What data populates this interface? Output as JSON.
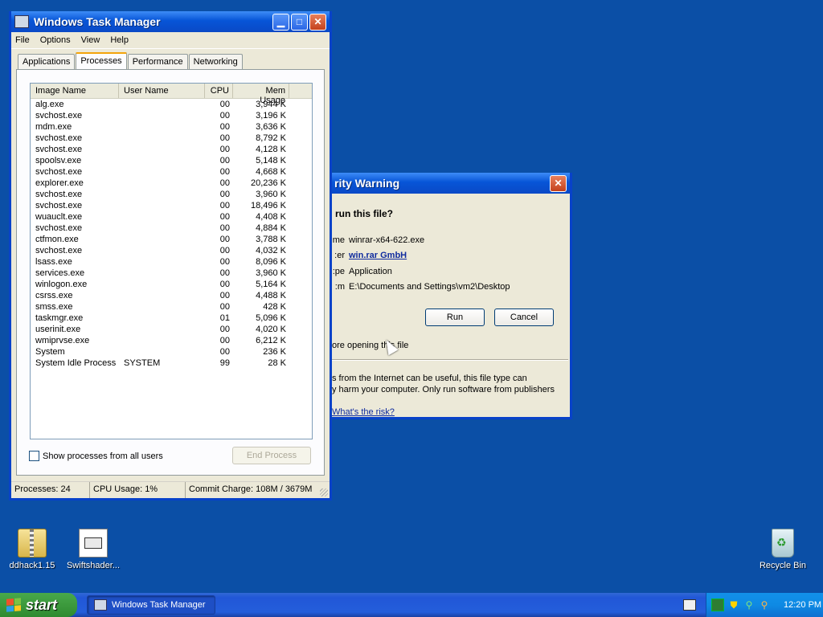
{
  "desktop": {
    "icons": [
      {
        "label": "ddhack1.15"
      },
      {
        "label": "Swiftshader..."
      },
      {
        "label": "Recycle Bin"
      }
    ]
  },
  "taskmgr": {
    "title": "Windows Task Manager",
    "menu": [
      "File",
      "Options",
      "View",
      "Help"
    ],
    "tabs": [
      "Applications",
      "Processes",
      "Performance",
      "Networking"
    ],
    "active_tab": "Processes",
    "columns": [
      "Image Name",
      "User Name",
      "CPU",
      "Mem Usage"
    ],
    "processes": [
      {
        "name": "alg.exe",
        "user": "",
        "cpu": "00",
        "mem": "3,944 K"
      },
      {
        "name": "svchost.exe",
        "user": "",
        "cpu": "00",
        "mem": "3,196 K"
      },
      {
        "name": "mdm.exe",
        "user": "",
        "cpu": "00",
        "mem": "3,636 K"
      },
      {
        "name": "svchost.exe",
        "user": "",
        "cpu": "00",
        "mem": "8,792 K"
      },
      {
        "name": "svchost.exe",
        "user": "",
        "cpu": "00",
        "mem": "4,128 K"
      },
      {
        "name": "spoolsv.exe",
        "user": "",
        "cpu": "00",
        "mem": "5,148 K"
      },
      {
        "name": "svchost.exe",
        "user": "",
        "cpu": "00",
        "mem": "4,668 K"
      },
      {
        "name": "explorer.exe",
        "user": "",
        "cpu": "00",
        "mem": "20,236 K"
      },
      {
        "name": "svchost.exe",
        "user": "",
        "cpu": "00",
        "mem": "3,960 K"
      },
      {
        "name": "svchost.exe",
        "user": "",
        "cpu": "00",
        "mem": "18,496 K"
      },
      {
        "name": "wuauclt.exe",
        "user": "",
        "cpu": "00",
        "mem": "4,408 K"
      },
      {
        "name": "svchost.exe",
        "user": "",
        "cpu": "00",
        "mem": "4,884 K"
      },
      {
        "name": "ctfmon.exe",
        "user": "",
        "cpu": "00",
        "mem": "3,788 K"
      },
      {
        "name": "svchost.exe",
        "user": "",
        "cpu": "00",
        "mem": "4,032 K"
      },
      {
        "name": "lsass.exe",
        "user": "",
        "cpu": "00",
        "mem": "8,096 K"
      },
      {
        "name": "services.exe",
        "user": "",
        "cpu": "00",
        "mem": "3,960 K"
      },
      {
        "name": "winlogon.exe",
        "user": "",
        "cpu": "00",
        "mem": "5,164 K"
      },
      {
        "name": "csrss.exe",
        "user": "",
        "cpu": "00",
        "mem": "4,488 K"
      },
      {
        "name": "smss.exe",
        "user": "",
        "cpu": "00",
        "mem": "428 K"
      },
      {
        "name": "taskmgr.exe",
        "user": "",
        "cpu": "01",
        "mem": "5,096 K"
      },
      {
        "name": "userinit.exe",
        "user": "",
        "cpu": "00",
        "mem": "4,020 K"
      },
      {
        "name": "wmiprvse.exe",
        "user": "",
        "cpu": "00",
        "mem": "6,212 K"
      },
      {
        "name": "System",
        "user": "",
        "cpu": "00",
        "mem": "236 K"
      },
      {
        "name": "System Idle Process",
        "user": "SYSTEM",
        "cpu": "99",
        "mem": "28 K"
      }
    ],
    "show_all_label": "Show processes from all users",
    "end_process_label": "End Process",
    "status": {
      "processes": "Processes: 24",
      "cpu": "CPU Usage: 1%",
      "commit": "Commit Charge: 108M / 3679M"
    }
  },
  "security_warning": {
    "title": "rity Warning",
    "question": "run this file?",
    "fields": [
      {
        "key": "me:",
        "value": "winrar-x64-622.exe",
        "link": false
      },
      {
        "key": "er:",
        "value": "win.rar GmbH",
        "link": true
      },
      {
        "key": "pe:",
        "value": "Application",
        "link": false
      },
      {
        "key": "m:",
        "value": "E:\\Documents and Settings\\vm2\\Desktop",
        "link": false
      }
    ],
    "run_label": "Run",
    "cancel_label": "Cancel",
    "checkbox_text": "ore opening this file",
    "warning_lines": [
      "s from the Internet can be useful, this file type can",
      "y harm your computer. Only run software from publishers"
    ],
    "risk_link": "What's the risk?"
  },
  "taskbar": {
    "start_label": "start",
    "task_button": "Windows Task Manager",
    "clock": "12:20 PM"
  }
}
